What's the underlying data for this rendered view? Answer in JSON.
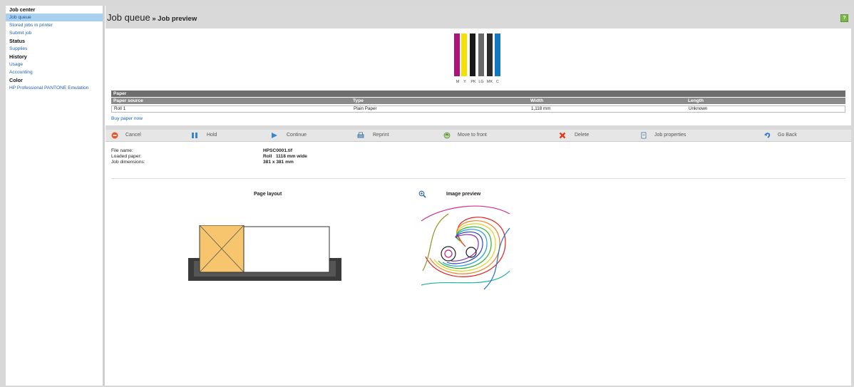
{
  "sidebar": {
    "items": [
      {
        "label": "Job center",
        "kind": "head"
      },
      {
        "label": "Job queue",
        "kind": "active"
      },
      {
        "label": "Stored jobs in printer",
        "kind": "link"
      },
      {
        "label": "Submit job",
        "kind": "link"
      },
      {
        "label": "Status",
        "kind": "head"
      },
      {
        "label": "Supplies",
        "kind": "link"
      },
      {
        "label": "History",
        "kind": "head"
      },
      {
        "label": "Usage",
        "kind": "link"
      },
      {
        "label": "Accounting",
        "kind": "link"
      },
      {
        "label": "Color",
        "kind": "head"
      },
      {
        "label": "HP Professional PANTONE Emulation",
        "kind": "link"
      }
    ]
  },
  "header": {
    "title_main": "Job queue",
    "title_sep": " » ",
    "title_sub": "Job preview",
    "help_label": "?"
  },
  "inks": {
    "labels": [
      "M",
      "Y",
      "PK",
      "LG",
      "MK",
      "C"
    ],
    "colors": [
      "#b0107a",
      "#f5e000",
      "#1a1a1a",
      "#6a6a6a",
      "#2a2a2a",
      "#1078c0"
    ]
  },
  "paper": {
    "section_title": "Paper",
    "columns": [
      "Paper source",
      "Type",
      "Width",
      "Length"
    ],
    "row": [
      "Roll 1",
      "Plain Paper",
      "1,118 mm",
      "Unknown"
    ],
    "buy_link": "Buy paper now"
  },
  "toolbar": {
    "cancel": "Cancel",
    "hold": "Hold",
    "continue": "Continue",
    "reprint": "Reprint",
    "move_to_front": "Move to front",
    "delete": "Delete",
    "job_properties": "Job properties",
    "go_back": "Go Back"
  },
  "job_info": {
    "file_name_label": "File name:",
    "file_name_value": "HPSC0001.tif",
    "loaded_paper_label": "Loaded paper:",
    "loaded_paper_value": "Roll   1118 mm wide",
    "job_dimensions_label": "Job dimensions:",
    "job_dimensions_value": "381 x 381 mm"
  },
  "preview": {
    "page_layout_label": "Page layout",
    "image_preview_label": "Image preview"
  },
  "colors": {
    "sidebar_active": "#a8d0f0",
    "link": "#2060b0",
    "help_green": "#7ab648",
    "layout_orange": "#f7c56e"
  }
}
